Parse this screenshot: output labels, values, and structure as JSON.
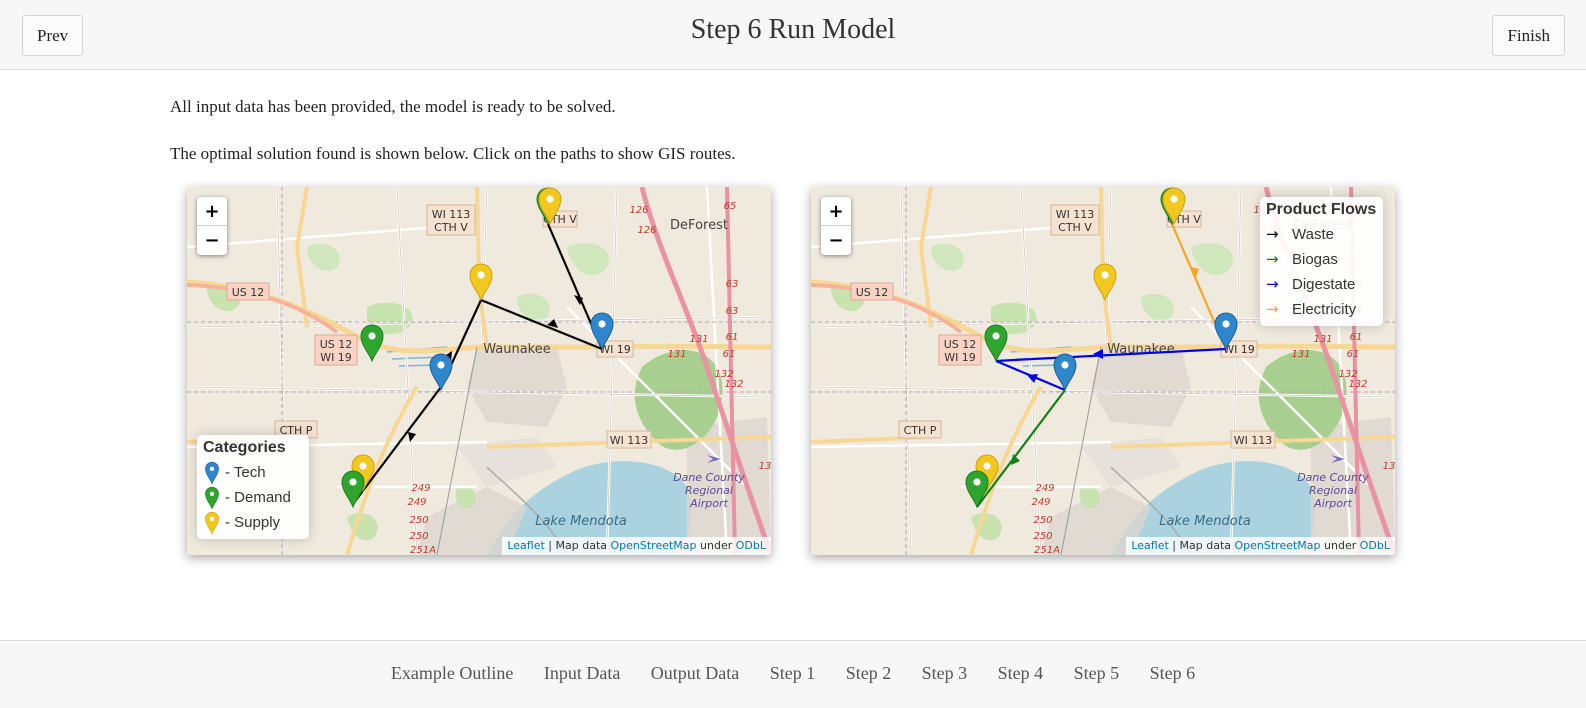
{
  "header": {
    "prev_label": "Prev",
    "title": "Step 6 Run Model",
    "finish_label": "Finish"
  },
  "intro": {
    "line1": "All input data has been provided, the model is ready to be solved.",
    "line2": "The optimal solution found is shown below. Click on the paths to show GIS routes."
  },
  "map_labels": {
    "roads": [
      "WI 113",
      "CTH V",
      "US 12",
      "US 12",
      "WI 19",
      "WI 19",
      "CTH P",
      "WI 113"
    ],
    "places": [
      "DeForest",
      "Waunakee",
      "Lake Mendota",
      "Dane County",
      "Regional",
      "Airport"
    ],
    "route_numbers": [
      "126",
      "126",
      "65",
      "63",
      "63",
      "131",
      "131",
      "61",
      "61",
      "132",
      "132",
      "13",
      "249",
      "249",
      "250",
      "250",
      "251A"
    ]
  },
  "map_controls": {
    "zoom_in": "+",
    "zoom_out": "−"
  },
  "attribution": {
    "leaflet": "Leaflet",
    "sep": " | Map data ",
    "osm": "OpenStreetMap",
    "under": " under ",
    "odbl": "ODbL"
  },
  "categories_legend": {
    "title": "Categories",
    "items": [
      {
        "label": "- Tech",
        "color": "#2e86cc",
        "icon": "map-marker-icon"
      },
      {
        "label": "- Demand",
        "color": "#2ea52e",
        "icon": "map-marker-icon"
      },
      {
        "label": "- Supply",
        "color": "#f2c81e",
        "icon": "map-marker-icon"
      }
    ]
  },
  "flows_legend": {
    "title": "Product Flows",
    "items": [
      {
        "label": "Waste",
        "color": "#000000"
      },
      {
        "label": "Biogas",
        "color": "#148014"
      },
      {
        "label": "Digestate",
        "color": "#0000ee"
      },
      {
        "label": "Electricity",
        "color": "#f5a623"
      }
    ]
  },
  "footer": {
    "links": [
      "Example Outline",
      "Input Data",
      "Output Data",
      "Step 1",
      "Step 2",
      "Step 3",
      "Step 4",
      "Step 5",
      "Step 6"
    ]
  }
}
